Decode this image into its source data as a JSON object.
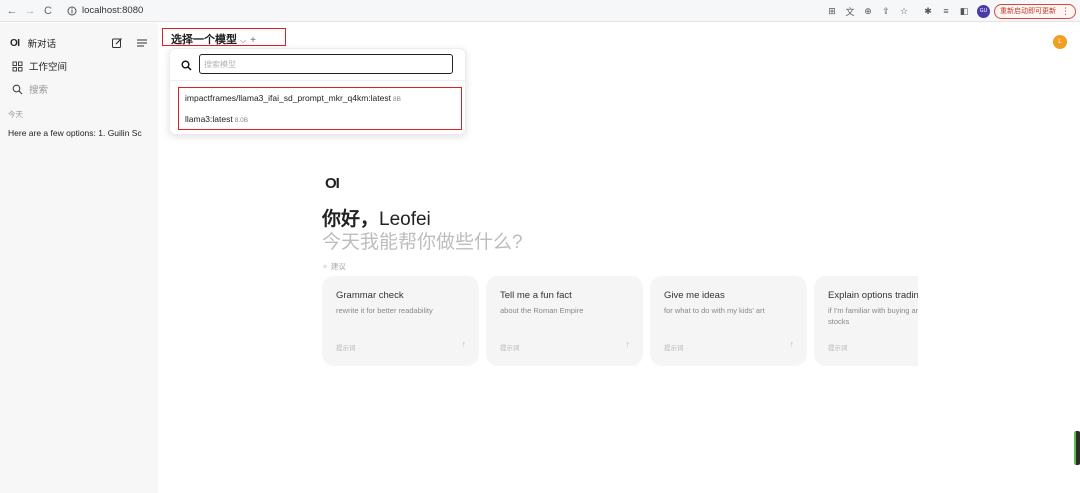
{
  "browser": {
    "url": "localhost:8080",
    "update_button": "重新启动即可更新",
    "profile_initials": "GU"
  },
  "sidebar": {
    "logo": "OI",
    "new_chat": "新对话",
    "workspace": "工作空间",
    "search_placeholder": "搜索",
    "section_today": "今天",
    "chats": [
      "Here are a few options: 1. Guilin Sc"
    ]
  },
  "header": {
    "model_selector": "选择一个模型",
    "user_initial": "L"
  },
  "model_dropdown": {
    "search_placeholder": "搜索模型",
    "models": [
      {
        "name": "impactframes/llama3_ifai_sd_prompt_mkr_q4km:latest",
        "size": "8B"
      },
      {
        "name": "llama3:latest",
        "size": "8.0B"
      }
    ]
  },
  "main": {
    "logo": "OI",
    "greeting_prefix": "你好，",
    "user_name": "Leofei",
    "subtitle": "今天我能帮你做些什么?",
    "suggestions_label": "建议",
    "cards": [
      {
        "title": "Grammar check",
        "desc": "rewrite it for better readability",
        "footer": "提示词"
      },
      {
        "title": "Tell me a fun fact",
        "desc": "about the Roman Empire",
        "footer": "提示词"
      },
      {
        "title": "Give me ideas",
        "desc": "for what to do with my kids' art",
        "footer": "提示词"
      },
      {
        "title": "Explain options trading",
        "desc": "if I'm familiar with buying and selling stocks",
        "footer": "提示词"
      }
    ]
  },
  "colors": {
    "highlight_border": "#e02020",
    "avatar": "#f0a020",
    "profile": "#4a3aa8"
  }
}
